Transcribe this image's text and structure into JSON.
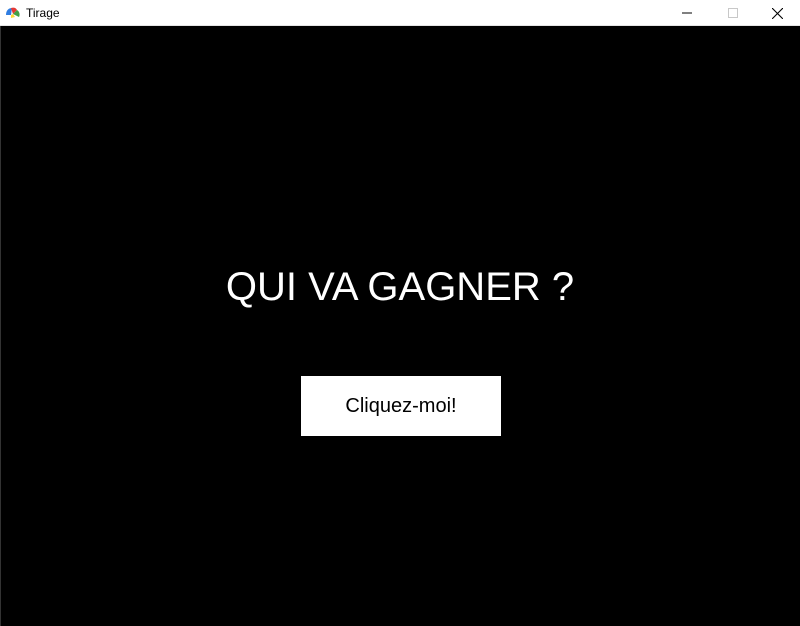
{
  "window": {
    "title": "Tirage",
    "icon": "tkinter-feather-icon",
    "controls": {
      "minimize_icon": "minimize-icon",
      "maximize_icon": "maximize-icon",
      "close_icon": "close-icon"
    }
  },
  "main": {
    "headline": "QUI VA GAGNER ?",
    "button_label": "Cliquez-moi!"
  },
  "colors": {
    "background": "#000000",
    "headline": "#ffffff",
    "button_bg": "#ffffff",
    "button_text": "#000000"
  }
}
